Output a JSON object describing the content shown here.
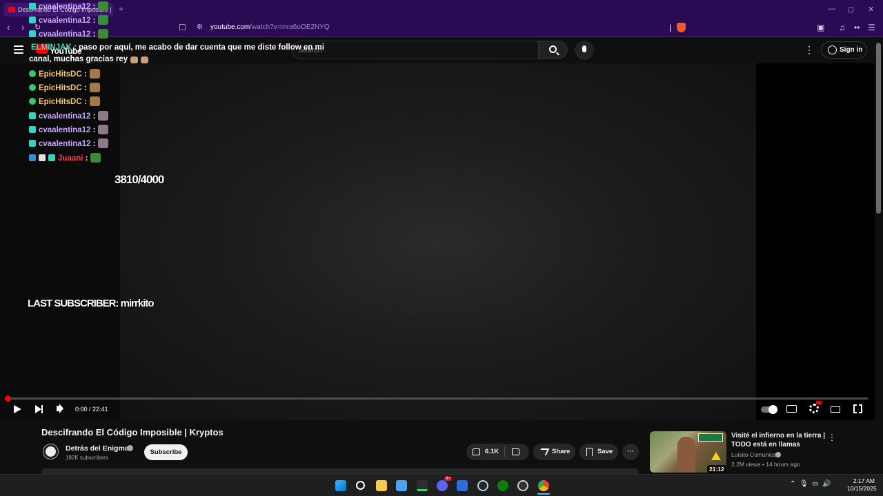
{
  "browser": {
    "tab_title": "Descifrando El Código Imposible | Kryptos",
    "new_tab": "+",
    "url_host": "youtube.com",
    "url_path": "/watch?v=mra6oOE2NYQ"
  },
  "header": {
    "logo_text": "YouTube",
    "search_placeholder": "Search",
    "more": "⋮",
    "signin_label": "Sign in"
  },
  "player": {
    "time_display": "0:00 / 22:41",
    "progress": 0.0
  },
  "overlay": {
    "chat": [
      {
        "user": "cvaalentina12",
        "message": "",
        "color": "#c8a8ff"
      },
      {
        "user": "cvaalentina12",
        "message": "",
        "color": "#c8a8ff"
      },
      {
        "user": "cvaalentina12",
        "message": "",
        "color": "#c8a8ff"
      },
      {
        "user": "ELMINJAK",
        "message": "paso por aquí, me acabo de dar cuenta que me diste follow en mi canal, muchas gracias rey",
        "color": "#4ad6c8"
      },
      {
        "user": "EpicHitsDC",
        "message": "",
        "color": "#f3c776"
      },
      {
        "user": "EpicHitsDC",
        "message": "",
        "color": "#f3c776"
      },
      {
        "user": "EpicHitsDC",
        "message": "",
        "color": "#f3c776"
      },
      {
        "user": "cvaalentina12",
        "message": "",
        "color": "#c8a8ff"
      },
      {
        "user": "cvaalentina12",
        "message": "",
        "color": "#c8a8ff"
      },
      {
        "user": "cvaalentina12",
        "message": "",
        "color": "#c8a8ff"
      },
      {
        "user": "Juaani",
        "message": "",
        "color": "#ff3b53"
      }
    ],
    "chat_message_line1": "paso por aquí, me acabo de dar cuenta que me diste follow en mi",
    "chat_message_line2": "canal, muchas gracias rey",
    "goal": "3810/4000",
    "last_subscriber": "LAST SUBSCRIBER: mirrkito"
  },
  "video": {
    "title": "Descifrando El Código Imposible | Kryptos",
    "channel_name": "Detrás del Enigma",
    "subscriber_count": "182K subscribers",
    "subscribe_label": "Subscribe",
    "like_count": "6.1K",
    "share_label": "Share",
    "save_label": "Save",
    "more_label": "···"
  },
  "recommended": {
    "title": "Visité el infierno en la tierra | TODO está en llamas",
    "channel": "Luisito Comunica",
    "meta": "2.2M views • 14 hours ago",
    "duration": "21:12",
    "more": "⋮"
  },
  "taskbar": {
    "discord_badge": "9+",
    "time": "2:17 AM",
    "date": "10/15/2025"
  },
  "colors": {
    "browser_chrome": "#2a0a52",
    "youtube_red": "#ff0000",
    "background": "#0f0f0f"
  }
}
